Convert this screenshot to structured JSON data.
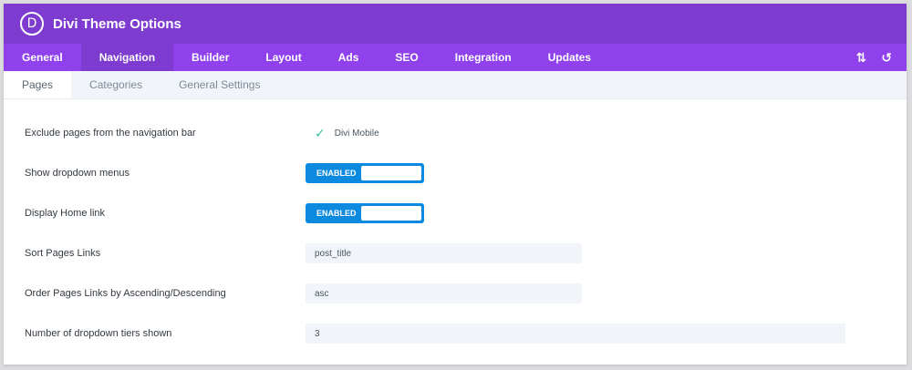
{
  "header": {
    "logo": "D",
    "title": "Divi Theme Options"
  },
  "tabs": [
    {
      "label": "General"
    },
    {
      "label": "Navigation"
    },
    {
      "label": "Builder"
    },
    {
      "label": "Layout"
    },
    {
      "label": "Ads"
    },
    {
      "label": "SEO"
    },
    {
      "label": "Integration"
    },
    {
      "label": "Updates"
    }
  ],
  "tools": {
    "sort_icon": "⇅",
    "reset_icon": "↺"
  },
  "subtabs": [
    {
      "label": "Pages"
    },
    {
      "label": "Categories"
    },
    {
      "label": "General Settings"
    }
  ],
  "settings": {
    "exclude": {
      "label": "Exclude pages from the navigation bar",
      "check": "✓",
      "option": "Divi Mobile"
    },
    "dropdown": {
      "label": "Show dropdown menus",
      "state": "ENABLED"
    },
    "home": {
      "label": "Display Home link",
      "state": "ENABLED"
    },
    "sort": {
      "label": "Sort Pages Links",
      "value": "post_title"
    },
    "order": {
      "label": "Order Pages Links by Ascending/Descending",
      "value": "asc"
    },
    "tiers": {
      "label": "Number of dropdown tiers shown",
      "value": "3"
    }
  },
  "colors": {
    "header": "#7e3bd0",
    "tabs": "#8f42ec",
    "toggle": "#0c8ae0",
    "check": "#3ac0a0"
  }
}
